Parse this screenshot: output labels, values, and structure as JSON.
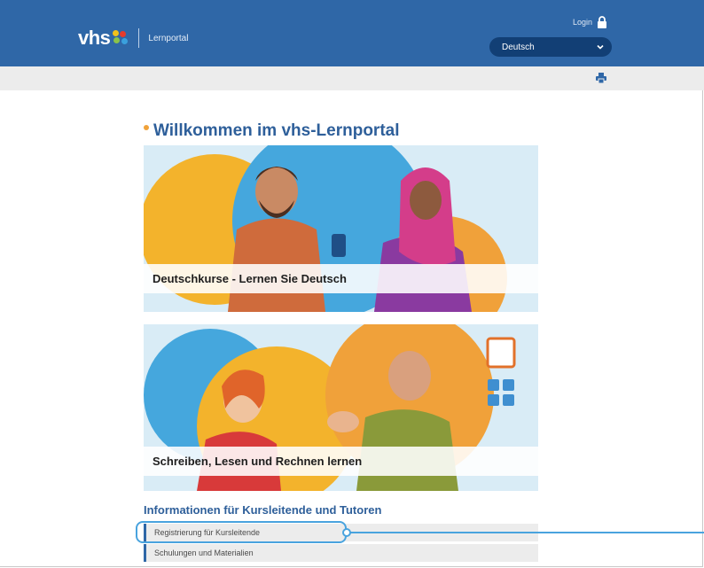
{
  "header": {
    "logo_text": "vhs",
    "portal_label": "Lernportal",
    "login_label": "Login",
    "language_selected": "Deutsch"
  },
  "content": {
    "title": "Willkommen im vhs-Lernportal",
    "cards": [
      {
        "caption": "Deutschkurse - Lernen Sie Deutsch"
      },
      {
        "caption": "Schreiben, Lesen und Rechnen lernen"
      }
    ],
    "info_heading": "Informationen für Kursleitende und Tutoren",
    "links": [
      {
        "label": "Registrierung für Kursleitende"
      },
      {
        "label": "Schulungen und Materialien"
      }
    ]
  },
  "icons": [
    "lock-icon",
    "chevron-down-icon",
    "print-icon"
  ],
  "colors": {
    "header_blue": "#2f67a7",
    "select_dark": "#123f75",
    "title_blue": "#2e5f9a",
    "highlight_blue": "#49a3de",
    "accent_orange": "#f0a23a"
  }
}
